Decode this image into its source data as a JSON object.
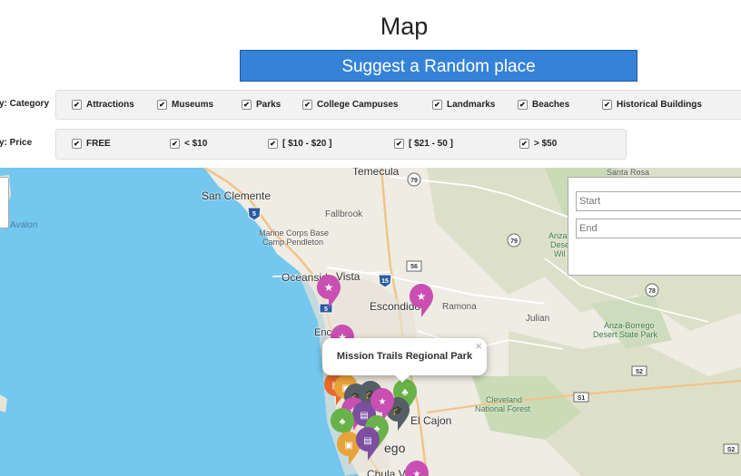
{
  "page": {
    "title": "Map"
  },
  "actions": {
    "random_button": "Suggest a Random place"
  },
  "filters": {
    "category": {
      "label": "y: Category",
      "options": [
        "Attractions",
        "Museums",
        "Parks",
        "College Campuses",
        "Landmarks",
        "Beaches",
        "Historical Buildings"
      ]
    },
    "price": {
      "label": "y: Price",
      "options": [
        "FREE",
        "< $10",
        "[ $10 - $20 ]",
        "[ $21 - 50 ]",
        "> $50"
      ]
    }
  },
  "directions": {
    "start_placeholder": "Start",
    "end_placeholder": "End"
  },
  "map": {
    "labels": {
      "temecula": "Temecula",
      "santa_rosa": "Santa Rosa",
      "san_clemente": "San Clemente",
      "fallbrook": "Fallbrook",
      "avalon": "Avalon",
      "marine_base": "Marine Corps Base",
      "camp": "Camp Pendleton",
      "oceanside": "Oceanside",
      "vista": "Vista",
      "escondido": "Escondido",
      "enc": "Enc",
      "ramona": "Ramona",
      "julian": "Julian",
      "anza_1": "Anza",
      "anza_2": "Dese",
      "anza_3": "Wil",
      "anza_borrego_1": "Anza-Borrego",
      "anza_borrego_2": "Desert State Park",
      "cleveland_1": "Cleveland",
      "cleveland_2": "National Forest",
      "el_cajon": "El Cajon",
      "diego": "ego",
      "chula_vista": "Chula V"
    },
    "shields": [
      "79",
      "5",
      "56",
      "15",
      "79",
      "78",
      "52",
      "S1",
      "S2",
      "S2"
    ],
    "popup": {
      "title": "Mission Trails Regional Park",
      "close": "×"
    },
    "colors": {
      "water": "#74c7ee",
      "land": "#eeece3",
      "terrain": "#d9dcc4",
      "forest": "#c5dbb5",
      "attractions_pin": "#c94fb2",
      "museum_pin": "#555f66",
      "park_pin": "#69b24a",
      "landmark_pin": "#e8a33a",
      "beach_pin": "#e56a2b",
      "campus_pin": "#7b4f9e",
      "primary_button": "#3583d8"
    },
    "pin_icons": [
      "star-icon",
      "image-icon",
      "graduation-cap-icon",
      "tree-icon",
      "document-icon"
    ]
  }
}
